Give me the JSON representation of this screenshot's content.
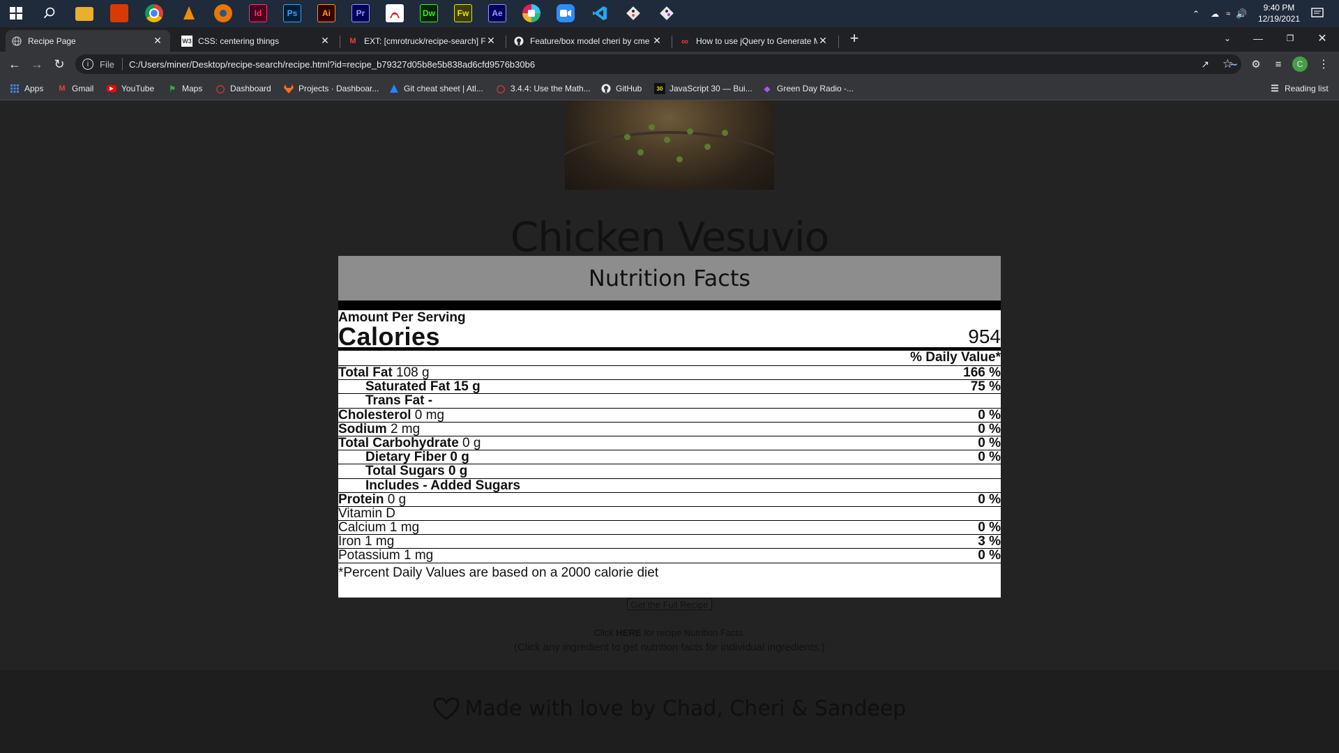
{
  "taskbar": {
    "apps": [
      "windows-start",
      "search",
      "file-explorer",
      "office",
      "chrome",
      "vlc",
      "blender",
      "indesign",
      "photoshop",
      "illustrator",
      "premiere",
      "acrobat",
      "dreamweaver",
      "fireworks",
      "after-effects",
      "slack",
      "zoom",
      "vscode",
      "git",
      "git-alt"
    ],
    "app_labels": {
      "indesign": "Id",
      "photoshop": "Ps",
      "illustrator": "Ai",
      "premiere": "Pr",
      "dreamweaver": "Dw",
      "fireworks": "Fw",
      "after_effects": "Ae"
    },
    "time": "9:40 PM",
    "date": "12/19/2021"
  },
  "tabs": [
    {
      "title": "Recipe Page",
      "active": true,
      "icon": "globe-icon"
    },
    {
      "title": "CSS: centering things",
      "active": false,
      "icon": "w3-icon"
    },
    {
      "title": "EXT: [cmrotruck/recipe-search] F",
      "active": false,
      "icon": "gmail-icon"
    },
    {
      "title": "Feature/box model cheri by cme",
      "active": false,
      "icon": "github-icon"
    },
    {
      "title": "How to use jQuery to Generate M",
      "active": false,
      "icon": "codepen-icon"
    }
  ],
  "toolbar": {
    "security_label": "File",
    "url": "C:/Users/miner/Desktop/recipe-search/recipe.html?id=recipe_b79327d05b8e5b838ad6cfd9576b30b6",
    "profile_initial": "C"
  },
  "bookmarks": [
    {
      "label": "Apps",
      "icon": "apps-grid-icon"
    },
    {
      "label": "Gmail",
      "icon": "gmail-icon"
    },
    {
      "label": "YouTube",
      "icon": "youtube-icon"
    },
    {
      "label": "Maps",
      "icon": "maps-icon"
    },
    {
      "label": "Dashboard",
      "icon": "dashboard-icon"
    },
    {
      "label": "Projects · Dashboar...",
      "icon": "gitlab-icon"
    },
    {
      "label": "Git cheat sheet | Atl...",
      "icon": "atlassian-icon"
    },
    {
      "label": "3.4.4: Use the Math...",
      "icon": "circle-icon"
    },
    {
      "label": "GitHub",
      "icon": "github-icon"
    },
    {
      "label": "JavaScript 30 — Bui...",
      "icon": "js30-icon"
    },
    {
      "label": "Green Day Radio -...",
      "icon": "radio-icon"
    }
  ],
  "reading_list": "Reading list",
  "recipe": {
    "title": "Chicken Vesuvio"
  },
  "nutrition": {
    "header": "Nutrition Facts",
    "amount_per_serving": "Amount Per Serving",
    "calories_label": "Calories",
    "calories_value": "954",
    "daily_value_header": "% Daily Value*",
    "rows": [
      {
        "label": "Total Fat",
        "amount": " 108 g",
        "pct": "166 %",
        "bold": true,
        "indent": false
      },
      {
        "label": "Saturated Fat 15 g",
        "amount": "",
        "pct": "75 %",
        "bold": false,
        "indent": true
      },
      {
        "label": "Trans Fat -",
        "amount": "",
        "pct": "",
        "bold": false,
        "indent": true
      },
      {
        "label": "Cholesterol",
        "amount": " 0 mg",
        "pct": "0 %",
        "bold": true,
        "indent": false
      },
      {
        "label": "Sodium",
        "amount": " 2 mg",
        "pct": "0 %",
        "bold": true,
        "indent": false
      },
      {
        "label": "Total Carbohydrate",
        "amount": " 0 g",
        "pct": "0 %",
        "bold": true,
        "indent": false
      },
      {
        "label": "Dietary Fiber 0 g",
        "amount": "",
        "pct": "0 %",
        "bold": false,
        "indent": true
      },
      {
        "label": "Total Sugars 0 g",
        "amount": "",
        "pct": "",
        "bold": false,
        "indent": true
      },
      {
        "label": "Includes - Added Sugars",
        "amount": "",
        "pct": "",
        "bold": false,
        "indent": true
      },
      {
        "label": "Protein",
        "amount": " 0 g",
        "pct": "0 %",
        "bold": true,
        "indent": false
      },
      {
        "label": "Vitamin D",
        "amount": "",
        "pct": "",
        "bold": false,
        "indent": false
      },
      {
        "label": "Calcium 1 mg",
        "amount": "",
        "pct": "0 %",
        "bold": false,
        "indent": false
      },
      {
        "label": "Iron 1 mg",
        "amount": "",
        "pct": "3 %",
        "bold": false,
        "indent": false
      },
      {
        "label": "Potassium 1 mg",
        "amount": "",
        "pct": "0 %",
        "bold": false,
        "indent": false
      }
    ],
    "footnote": "*Percent Daily Values are based on a 2000 calorie diet"
  },
  "actions": {
    "full_recipe": "Get the Full Recipe",
    "click_prefix": "Click ",
    "click_here": "HERE",
    "click_suffix": " for recipe Nutrition Facts.",
    "click_hint": "(Click any ingredient to get nutrition facts for individual ingredients.)"
  },
  "footer": {
    "text": "Made with love by Chad, Cheri & Sandeep",
    "icon": "heart-icon"
  },
  "colors": {
    "page_bg": "#232323",
    "nutrition_header_bg": "#8d8d8d",
    "footer_bg": "#1e1e1e",
    "taskbar_bg": "#1f2a3b",
    "chrome_tab_bg": "#35363a"
  }
}
